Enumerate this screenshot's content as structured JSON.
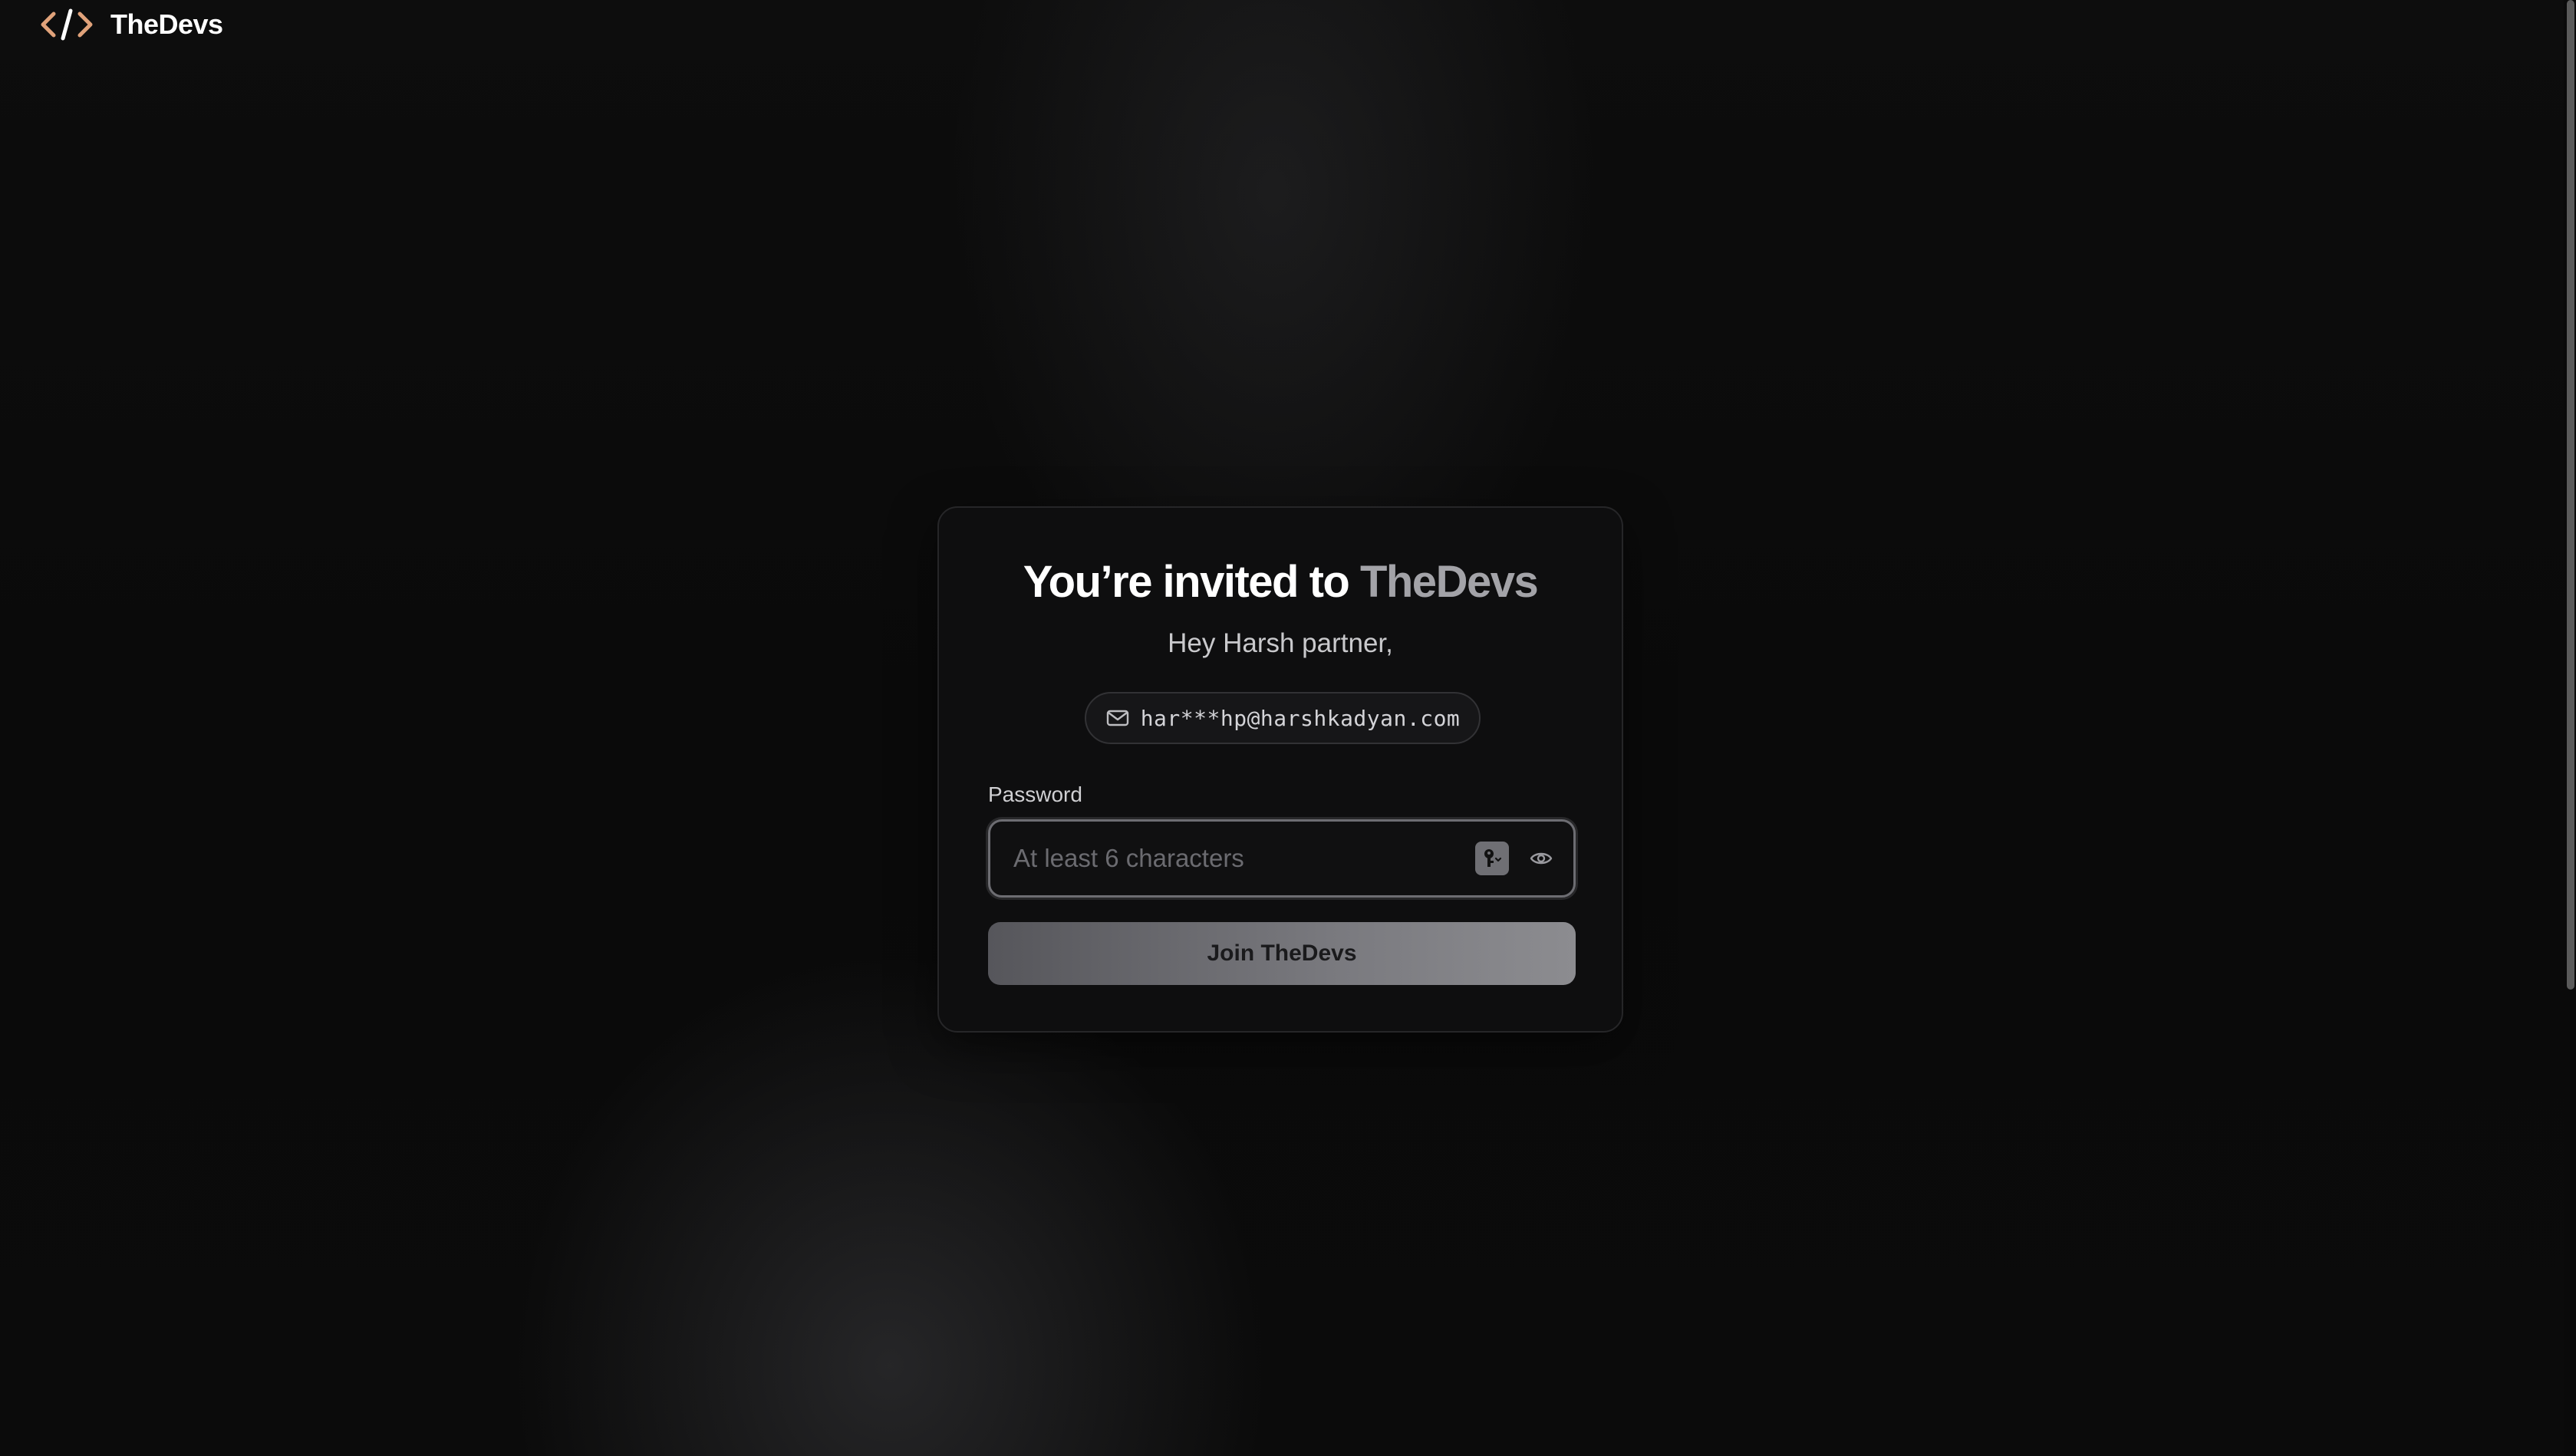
{
  "brand": {
    "name": "TheDevs",
    "logo_icon": "code-brackets-icon",
    "logo_color": "#e0a27a"
  },
  "invite": {
    "title_prefix": "You’re invited to ",
    "title_accent": "TheDevs",
    "greeting": "Hey Harsh partner,",
    "email": "har***hp@harshkadyan.com",
    "email_icon": "mail-icon"
  },
  "password": {
    "label": "Password",
    "placeholder": "At least 6 characters",
    "value": "",
    "key_icon": "password-manager-key-icon",
    "eye_icon": "eye-icon"
  },
  "actions": {
    "join_label": "Join TheDevs"
  },
  "colors": {
    "background": "#0a0a0a",
    "card_border": "#262628",
    "accent_gray": "#a3a3a8",
    "button_gradient_start": "#56565b",
    "button_gradient_end": "#8c8c90"
  }
}
